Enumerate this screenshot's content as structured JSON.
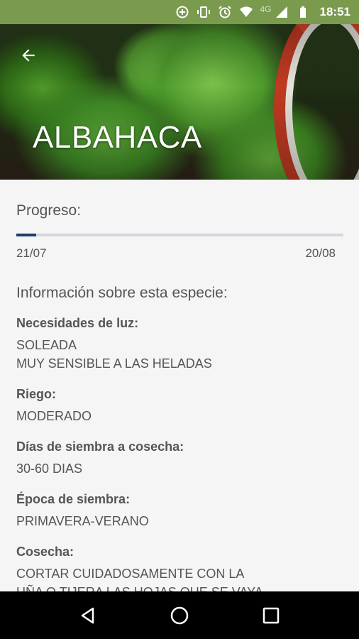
{
  "status_bar": {
    "network": "4G",
    "time": "18:51",
    "icons": [
      "data-saver-icon",
      "vibrate-icon",
      "alarm-icon",
      "wifi-icon",
      "signal-icon",
      "battery-icon"
    ]
  },
  "header": {
    "title": "ALBAHACA",
    "back_icon": "arrow-back-icon"
  },
  "progress": {
    "label": "Progreso:",
    "start_date": "21/07",
    "end_date": "20/08",
    "fraction": 0.06,
    "color": "#1f3d66"
  },
  "info": {
    "heading": "Información sobre esta especie:",
    "fields": [
      {
        "label": "Necesidades de luz:",
        "value": "SOLEADA\nMUY SENSIBLE A LAS HELADAS"
      },
      {
        "label": "Riego:",
        "value": "MODERADO"
      },
      {
        "label": "Días de siembra a cosecha:",
        "value": "30-60 DIAS"
      },
      {
        "label": "Época de siembra:",
        "value": "PRIMAVERA-VERANO"
      },
      {
        "label": "Cosecha:",
        "value": "CORTAR CUIDADOSAMENTE CON LA\nUÑA O TIJERA LAS HOJAS QUE SE VAYA"
      }
    ]
  },
  "nav_bar": {
    "icons": [
      "nav-back-icon",
      "nav-home-icon",
      "nav-recents-icon"
    ]
  },
  "colors": {
    "status_bar": "#7a9a4e",
    "background": "#f5f5f5",
    "text": "#555555"
  }
}
